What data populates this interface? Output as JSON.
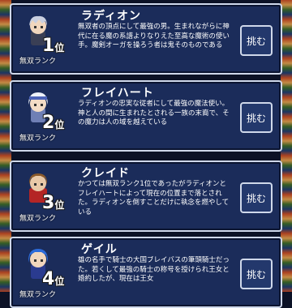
{
  "ranking": [
    {
      "name": "ラディオン",
      "description": "無双者の頂点にして最強の男。生まれながらに神代に在る魔の系譜よりなりえた至高な魔術の使い手。魔剣オーガを操ろう者は鬼そのものである",
      "rank_number": "1",
      "rank_suffix": "位",
      "rank_label": "無双ランク",
      "button_label": "挑む",
      "hair_color": "#c9cfe0",
      "outfit_color": "#3a3f55"
    },
    {
      "name": "フレイハート",
      "description": "ラディオンの忠実な従者にして最強の魔法使い。神と人の間に生まれたとされる一族の末裔で、その魔力は人の域を越えている",
      "rank_number": "2",
      "rank_suffix": "位",
      "rank_label": "無双ランク",
      "button_label": "挑む",
      "hair_color": "#eef2fa",
      "outfit_color": "#6f7fb5"
    },
    {
      "name": "クレイド",
      "description": "かつては無双ランク1位であったがラディオンとフレイハートによって現在の位置まで落とされた。ラディオンを倒すことだけに執念を燃やしている",
      "rank_number": "3",
      "rank_suffix": "位",
      "rank_label": "無双ランク",
      "button_label": "挑む",
      "hair_color": "#8a5a2b",
      "outfit_color": "#b42525"
    },
    {
      "name": "ゲイル",
      "description": "雄の名手で騎士の大国ブレイバスの筆頭騎士だった。若くして最強の騎士の称号を授けられ王女と婚約したが、現在は王女",
      "rank_number": "4",
      "rank_suffix": "位",
      "rank_label": "無双ランク",
      "button_label": "挑む",
      "hair_color": "#2d6bd9",
      "outfit_color": "#2a3b8f"
    }
  ]
}
